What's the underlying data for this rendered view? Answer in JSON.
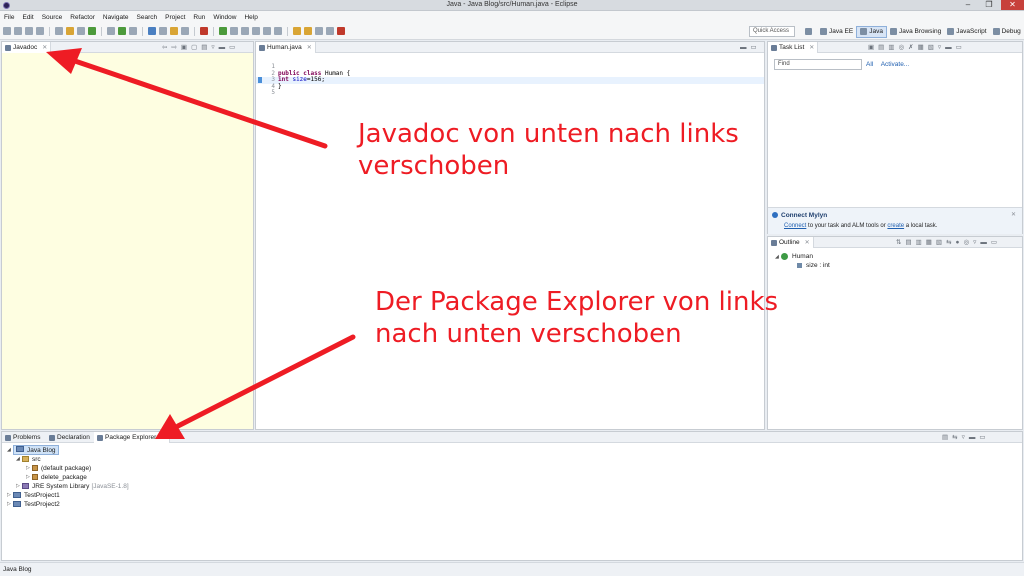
{
  "window": {
    "title": "Java - Java Blog/src/Human.java - Eclipse",
    "min": "–",
    "max": "❐",
    "close": "✕"
  },
  "menu": [
    "File",
    "Edit",
    "Source",
    "Refactor",
    "Navigate",
    "Search",
    "Project",
    "Run",
    "Window",
    "Help"
  ],
  "toolbar": {
    "quick_access_placeholder": "Quick Access",
    "perspectives": [
      {
        "label": "Java EE",
        "active": false
      },
      {
        "label": "Java",
        "active": true
      },
      {
        "label": "Java Browsing",
        "active": false
      },
      {
        "label": "JavaScript",
        "active": false
      },
      {
        "label": "Debug",
        "active": false
      }
    ]
  },
  "javadoc": {
    "tab": "Javadoc",
    "close": "✕"
  },
  "editor": {
    "tab": "Human.java",
    "close": "✕",
    "lines": [
      {
        "no": "1",
        "text": ""
      },
      {
        "no": "2",
        "kw": "public class",
        "rest": " Human {"
      },
      {
        "no": "3",
        "kw": "int",
        "field": " size",
        "rest": "=156;"
      },
      {
        "no": "4",
        "text": "}"
      },
      {
        "no": "5",
        "text": ""
      }
    ]
  },
  "tasklist": {
    "tab": "Task List",
    "close": "✕",
    "find_placeholder": "Find",
    "all": "All",
    "activate": "Activate..."
  },
  "mylyn": {
    "title": "Connect Mylyn",
    "connect_link": "Connect",
    "text1": " to your task and ALM tools or ",
    "create_link": "create",
    "text2": " a local task.",
    "close": "✕"
  },
  "outline": {
    "tab": "Outline",
    "close": "✕",
    "items": [
      "Human",
      "size : int"
    ]
  },
  "bottom": {
    "tabs": [
      "Problems",
      "Declaration",
      "Package Explorer"
    ],
    "active_tab": "Package Explorer",
    "close": "✕",
    "tree": {
      "project": "Java Blog",
      "src": "src",
      "default_package": "(default package)",
      "delete_package": "delete_package",
      "jre": "JRE System Library",
      "jre_version": "[JavaSE-1.8]",
      "project2": "TestProject1",
      "project3": "TestProject2"
    }
  },
  "status": {
    "text": "Java Blog"
  },
  "annotations": {
    "javadoc_line1": "Javadoc von unten nach links",
    "javadoc_line2": "verschoben",
    "explorer_line1": "Der Package Explorer von links",
    "explorer_line2": "nach unten verschoben"
  },
  "colors": {
    "annotation": "#ee1c24",
    "javadoc_bg": "#fefee1",
    "keyword": "#7f0055",
    "field": "#0000c0"
  }
}
